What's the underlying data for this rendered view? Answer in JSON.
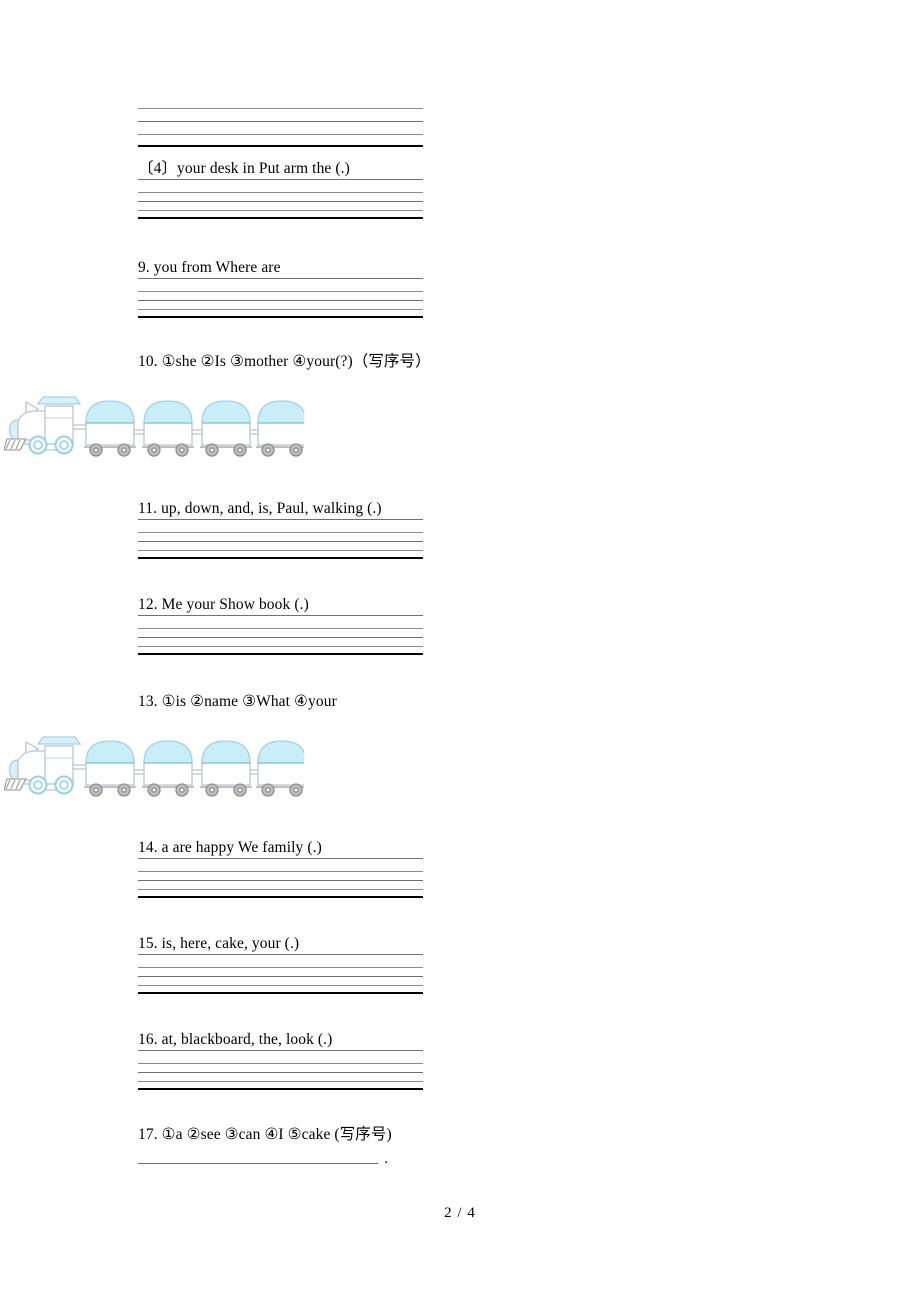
{
  "document": {
    "type": "worksheet",
    "language": "en-zh",
    "footer": "2 / 4"
  },
  "blocks": [
    {
      "kind": "lines_only",
      "name": "answer-lines-q8-continued",
      "lines": [
        "thin",
        "mid",
        "thin",
        "thick"
      ]
    },
    {
      "kind": "question",
      "name": "question-4-bracketed",
      "number": "",
      "text": "〔4〕your  desk  in  Put arm the (.)",
      "lines": [
        "under",
        "thin",
        "mid",
        "thin",
        "thick"
      ]
    },
    {
      "kind": "question",
      "name": "question-9",
      "number": "9.",
      "text": "9. you   from   Where   are",
      "lines": [
        "under",
        "thin",
        "mid",
        "thin",
        "thick"
      ]
    },
    {
      "kind": "question-image",
      "name": "question-10",
      "number": "10.",
      "text": "10. ①she ②Is ③mother ④your(?)（写序号）",
      "image": "train-graphic"
    },
    {
      "kind": "question",
      "name": "question-11",
      "number": "11.",
      "text": "11. up, down, and, is, Paul, walking (.)",
      "lines": [
        "under",
        "thin",
        "mid",
        "thin",
        "thick"
      ]
    },
    {
      "kind": "question",
      "name": "question-12",
      "number": "12.",
      "text": "12. Me your   Show   book (.)",
      "lines": [
        "under",
        "thin",
        "mid",
        "thin",
        "thick"
      ]
    },
    {
      "kind": "question-image",
      "name": "question-13",
      "number": "13.",
      "text": "13. ①is   ②name   ③What   ④your",
      "image": "train-graphic"
    },
    {
      "kind": "question",
      "name": "question-14",
      "number": "14.",
      "text": "14. a    are   happy   We   family  (.)",
      "lines": [
        "under",
        "thin",
        "mid",
        "thin",
        "thick"
      ]
    },
    {
      "kind": "question",
      "name": "question-15",
      "number": "15.",
      "text": "15. is, here, cake, your (.)",
      "lines": [
        "under",
        "thin",
        "mid",
        "thin",
        "thick"
      ]
    },
    {
      "kind": "question",
      "name": "question-16",
      "number": "16.",
      "text": "16. at, blackboard, the, look (.)",
      "lines": [
        "under",
        "thin",
        "mid",
        "thin",
        "thick"
      ]
    },
    {
      "kind": "question-blank",
      "name": "question-17",
      "number": "17.",
      "text": "17. ①a  ②see  ③can  ④I ⑤cake (写序号)",
      "answer_terminator": "."
    }
  ],
  "q4": {
    "text": "〔4〕your  desk  in  Put arm the (.)"
  },
  "q9": {
    "text": "9. you   from   Where   are"
  },
  "q10": {
    "text": "10. ①she ②Is ③mother ④your(?)（写序号）"
  },
  "q11": {
    "text": "11. up, down, and, is, Paul, walking (.)"
  },
  "q12": {
    "text": "12. Me your   Show   book (.)"
  },
  "q13": {
    "text": "13. ①is   ②name   ③What   ④your"
  },
  "q14": {
    "text": "14. a    are   happy   We   family  (.)"
  },
  "q15": {
    "text": "15. is, here, cake, your (.)"
  },
  "q16": {
    "text": "16. at, blackboard, the, look (.)"
  },
  "q17": {
    "text": "17. ①a  ②see  ③can  ④I ⑤cake (写序号)",
    "terminator": "."
  },
  "footer": {
    "page": "2 / 4"
  },
  "graphics": {
    "train": {
      "name": "train-graphic",
      "cars": 4,
      "colors": {
        "dome_fill": "#c9eef7",
        "outline": "#b9c6cf",
        "wheel": "#9a9a9a",
        "body_fill": "#ffffff",
        "loco_accent": "#bfe6f2"
      }
    }
  }
}
